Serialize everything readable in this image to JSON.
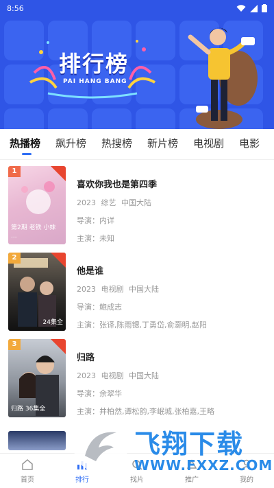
{
  "status_bar": {
    "time": "8:56"
  },
  "banner": {
    "title_cn": "排行榜",
    "title_en": "PAI HANG BANG"
  },
  "tabs": [
    {
      "label": "热播榜",
      "active": true
    },
    {
      "label": "飙升榜"
    },
    {
      "label": "热搜榜"
    },
    {
      "label": "新片榜"
    },
    {
      "label": "电视剧"
    },
    {
      "label": "电影"
    }
  ],
  "items": [
    {
      "rank": "1",
      "poster_text": "第2期 老铁 小妹 ...",
      "title": "喜欢你我也是第四季",
      "year": "2023",
      "genre": "综艺",
      "region": "中国大陆",
      "director": "导演：内详",
      "cast": "主演：未知"
    },
    {
      "rank": "2",
      "poster_text": "24集全",
      "title": "他是谁",
      "year": "2023",
      "genre": "电视剧",
      "region": "中国大陆",
      "director": "导演：鲍成志",
      "cast": "主演：张译,陈雨锶,丁勇岱,俞灏明,赵阳"
    },
    {
      "rank": "3",
      "poster_text": "归路 36集全",
      "title": "归路",
      "year": "2023",
      "genre": "电视剧",
      "region": "中国大陆",
      "director": "导演：余翠华",
      "cast": "主演：井柏然,谭松韵,李岷城,张柏嘉,王略"
    }
  ],
  "bottom_nav": [
    {
      "label": "首页",
      "icon": "home-icon"
    },
    {
      "label": "排行",
      "icon": "ranking-icon",
      "active": true
    },
    {
      "label": "找片",
      "icon": "find-icon"
    },
    {
      "label": "推广",
      "icon": "promote-icon"
    },
    {
      "label": "我的",
      "icon": "profile-icon"
    }
  ],
  "watermark": {
    "text": "飞翔下载",
    "url": "WWW.FXXZ.COM"
  },
  "colors": {
    "accent": "#2f6ef5",
    "banner": "#2f55e6",
    "watermark": "#2a8be8"
  }
}
